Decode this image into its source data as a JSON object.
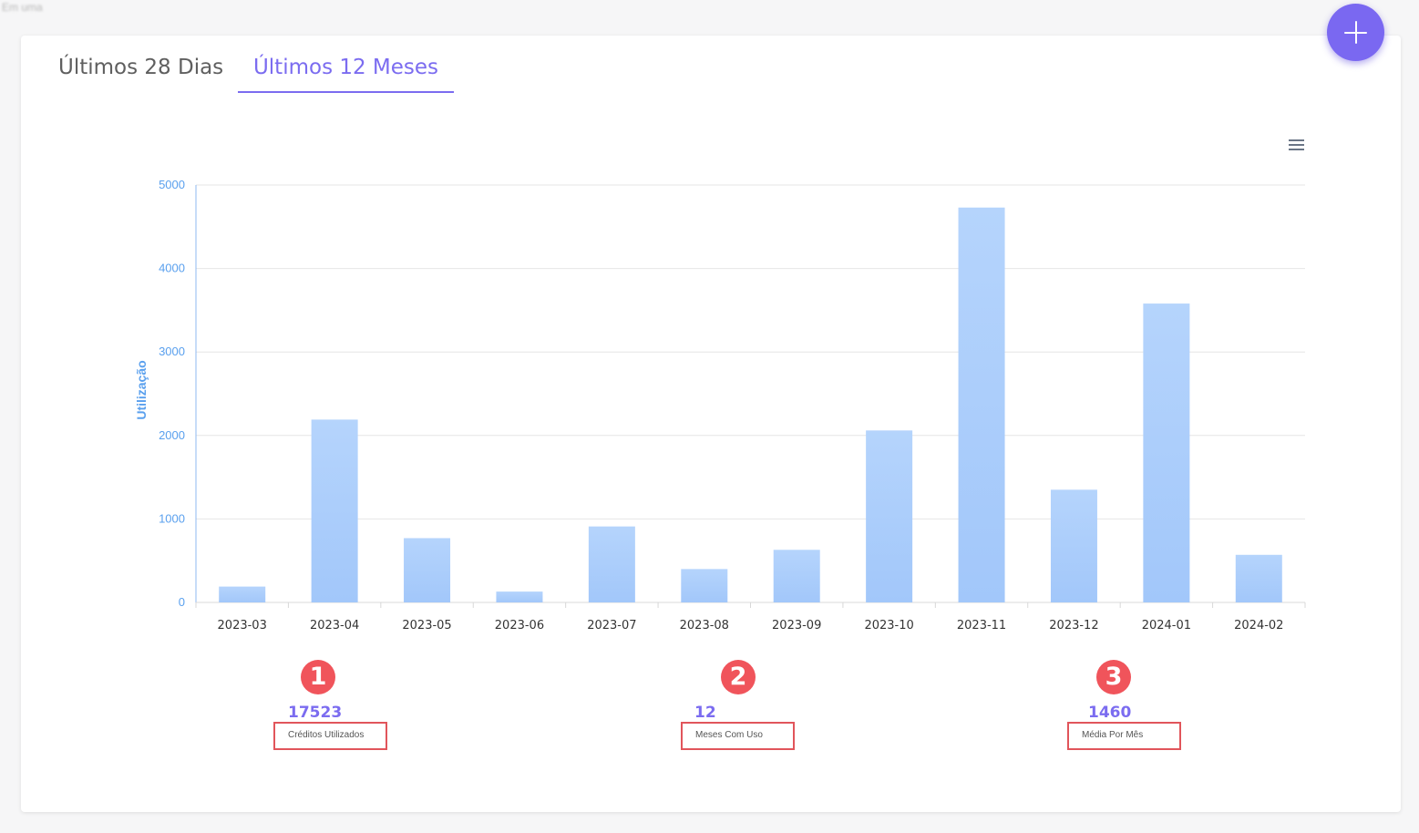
{
  "header": {
    "faint_text": "Em uma"
  },
  "tabs": [
    {
      "label": "Últimos 28 Dias",
      "active": false
    },
    {
      "label": "Últimos 12 Meses",
      "active": true
    }
  ],
  "fab": {
    "icon": "plus-icon"
  },
  "chart_menu": {
    "icon": "hamburger-menu-icon"
  },
  "chart_data": {
    "type": "bar",
    "title": "",
    "xlabel": "",
    "ylabel": "Utilização",
    "ylim": [
      0,
      5000
    ],
    "yticks": [
      "0",
      "1000",
      "2000",
      "3000",
      "4000",
      "5000"
    ],
    "grid": true,
    "bar_color": "#a9ccfb",
    "categories": [
      "2023-03",
      "2023-04",
      "2023-05",
      "2023-06",
      "2023-07",
      "2023-08",
      "2023-09",
      "2023-10",
      "2023-11",
      "2023-12",
      "2024-01",
      "2024-02"
    ],
    "values": [
      190,
      2190,
      770,
      130,
      910,
      400,
      630,
      2060,
      4730,
      1350,
      3580,
      570
    ]
  },
  "stats": [
    {
      "badge": "1",
      "value": "17523",
      "label": "Créditos Utilizados"
    },
    {
      "badge": "2",
      "value": "12",
      "label": "Meses Com Uso"
    },
    {
      "badge": "3",
      "value": "1460",
      "label": "Média Por Mês"
    }
  ],
  "colors": {
    "accent": "#7b6cf0",
    "fab": "#7a68f1",
    "axis_label": "#5aa0ee",
    "bar": "#a9ccfb",
    "highlight_red": "#e1555b"
  }
}
